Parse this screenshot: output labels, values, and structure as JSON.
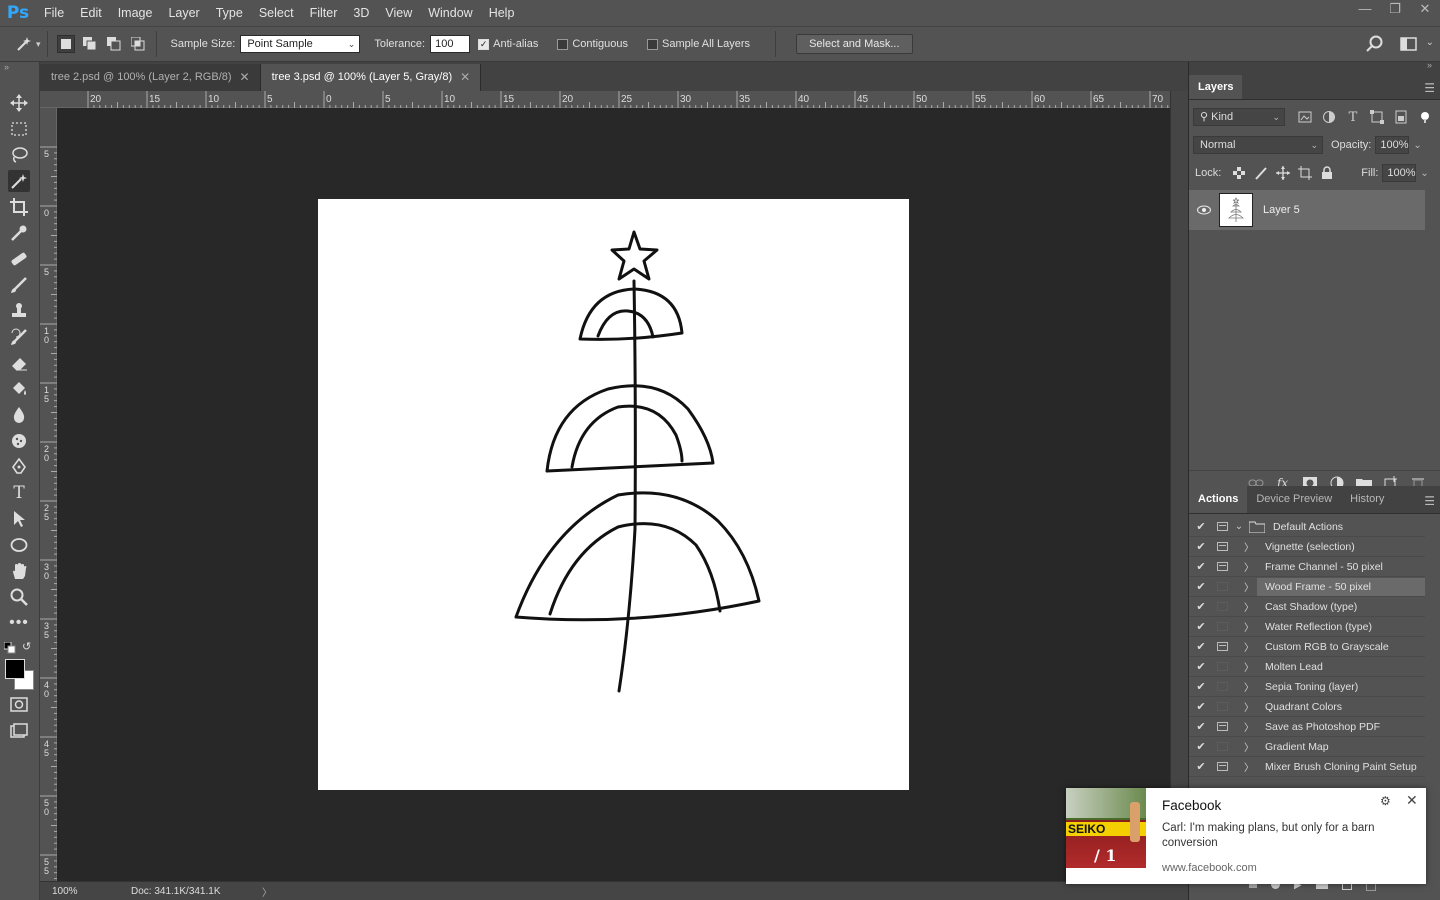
{
  "app": {
    "logo": "Ps"
  },
  "menu": [
    "File",
    "Edit",
    "Image",
    "Layer",
    "Type",
    "Select",
    "Filter",
    "3D",
    "View",
    "Window",
    "Help"
  ],
  "options": {
    "sample_size_label": "Sample Size:",
    "sample_size_value": "Point Sample",
    "tolerance_label": "Tolerance:",
    "tolerance_value": "100",
    "antialias_label": "Anti-alias",
    "contiguous_label": "Contiguous",
    "sample_all_label": "Sample All Layers",
    "select_mask_label": "Select and Mask..."
  },
  "tabs": [
    {
      "label": "tree 2.psd @ 100% (Layer 2, RGB/8)",
      "active": false
    },
    {
      "label": "tree 3.psd @ 100% (Layer 5, Gray/8)",
      "active": true
    }
  ],
  "ruler_top": [
    "20",
    "15",
    "10",
    "5",
    "0",
    "5",
    "10",
    "15",
    "20",
    "25",
    "30",
    "35",
    "40",
    "45",
    "50",
    "55",
    "60",
    "65",
    "70"
  ],
  "ruler_left": [
    "5",
    "0",
    "5",
    "1 0",
    "1 5",
    "2 0",
    "2 5",
    "3 0",
    "3 5",
    "4 0",
    "4 5",
    "5 0",
    "5 5"
  ],
  "status": {
    "zoom": "100%",
    "doc": "Doc: 341.1K/341.1K"
  },
  "layers_panel": {
    "tab": "Layers",
    "filter_label": "Kind",
    "blend_mode": "Normal",
    "opacity_label": "Opacity:",
    "opacity_value": "100%",
    "lock_label": "Lock:",
    "fill_label": "Fill:",
    "fill_value": "100%",
    "layer_name": "Layer 5"
  },
  "actions_panel": {
    "tabs": [
      "Actions",
      "Device Preview",
      "History"
    ],
    "items": [
      {
        "name": "Default Actions",
        "dialog": true
      },
      {
        "name": "Vignette (selection)",
        "dialog": true
      },
      {
        "name": "Frame Channel - 50 pixel",
        "dialog": true
      },
      {
        "name": "Wood Frame - 50 pixel",
        "dialog": false,
        "selected": true
      },
      {
        "name": "Cast Shadow (type)",
        "dialog": false
      },
      {
        "name": "Water Reflection (type)",
        "dialog": false
      },
      {
        "name": "Custom RGB to Grayscale",
        "dialog": true
      },
      {
        "name": "Molten Lead",
        "dialog": false
      },
      {
        "name": "Sepia Toning (layer)",
        "dialog": false
      },
      {
        "name": "Quadrant Colors",
        "dialog": false
      },
      {
        "name": "Save as Photoshop PDF",
        "dialog": true
      },
      {
        "name": "Gradient Map",
        "dialog": false
      },
      {
        "name": "Mixer Brush Cloning Paint Setup",
        "dialog": true
      }
    ]
  },
  "notification": {
    "title": "Facebook",
    "body": "Carl: I'm making plans, but only for a barn conversion",
    "url": "www.facebook.com",
    "image_text": "SEIKO",
    "image_number": "/ 1"
  },
  "colors": {
    "accent": "#31a8ff",
    "panel": "#535353",
    "pasteboard": "#282828"
  }
}
